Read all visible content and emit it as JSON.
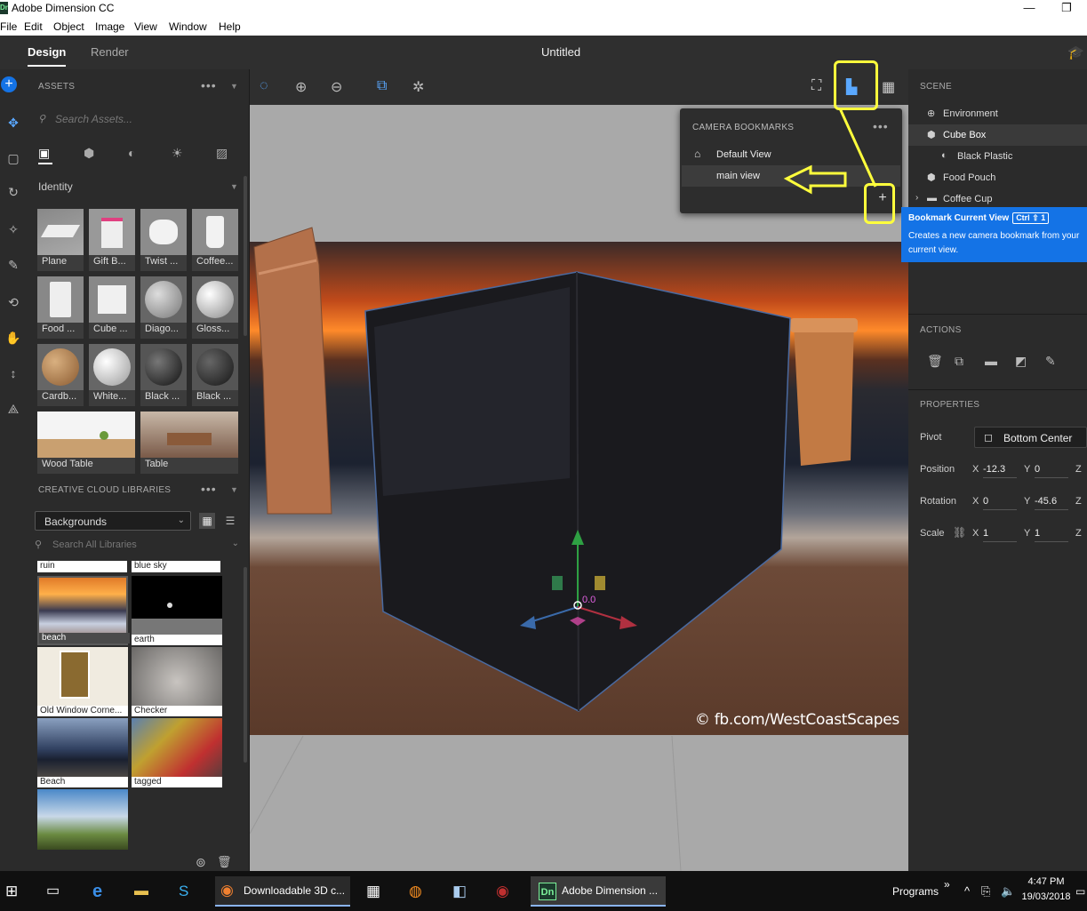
{
  "window": {
    "app_icon": "Dn",
    "title": "Adobe Dimension CC",
    "minimize": "—",
    "restore": "❐"
  },
  "menu": [
    "File",
    "Edit",
    "Object",
    "Image",
    "View",
    "Window",
    "Help"
  ],
  "tabs": {
    "design": "Design",
    "render": "Render",
    "document": "Untitled"
  },
  "assets": {
    "header": "ASSETS",
    "more": "•••",
    "search_placeholder": "Search Assets...",
    "filter": "Identity",
    "items": [
      "Plane",
      "Gift B...",
      "Twist ...",
      "Coffee...",
      "Food ...",
      "Cube ...",
      "Diago...",
      "Gloss...",
      "Cardb...",
      "White...",
      "Black ...",
      "Black ...",
      "Wood Table",
      "Table"
    ]
  },
  "libraries": {
    "header": "CREATIVE CLOUD LIBRARIES",
    "more": "•••",
    "selected": "Backgrounds",
    "search_placeholder": "Search All Libraries",
    "top_captions": [
      "ruin",
      "blue sky"
    ],
    "items": [
      "beach",
      "earth",
      "Old Window Corne...",
      "Checker",
      "Beach",
      "tagged"
    ]
  },
  "viewport": {
    "watermark": "© fb.com/WestCoastScapes",
    "gizmo_value": "0.0"
  },
  "bookmarks": {
    "header": "CAMERA BOOKMARKS",
    "more": "•••",
    "items": [
      "Default View",
      "main view"
    ],
    "add": "+"
  },
  "tooltip": {
    "title": "Bookmark Current View",
    "shortcut": "Ctrl ⇧ 1",
    "text": "Creates a new camera bookmark from your current view."
  },
  "scene": {
    "header": "SCENE",
    "items": [
      "Environment",
      "Cube Box",
      "Black Plastic",
      "Food Pouch",
      "Coffee Cup"
    ]
  },
  "actions": {
    "header": "ACTIONS"
  },
  "properties": {
    "header": "PROPERTIES",
    "pivot_label": "Pivot",
    "pivot_value": "Bottom Center",
    "position_label": "Position",
    "rotation_label": "Rotation",
    "scale_label": "Scale",
    "x": "X",
    "y": "Y",
    "z": "Z",
    "position": {
      "x": "-12.3",
      "y": "0"
    },
    "rotation": {
      "x": "0",
      "y": "-45.6"
    },
    "scale": {
      "x": "1",
      "y": "1"
    }
  },
  "taskbar": {
    "firefox": "Downloadable 3D c...",
    "dimension": "Adobe Dimension ...",
    "programs": "Programs",
    "chevron": "»",
    "time": "4:47 PM",
    "date": "19/03/2018"
  },
  "colors": {
    "accent": "#1473e6",
    "highlight": "#ffff3c",
    "panel": "#2b2b2b"
  }
}
